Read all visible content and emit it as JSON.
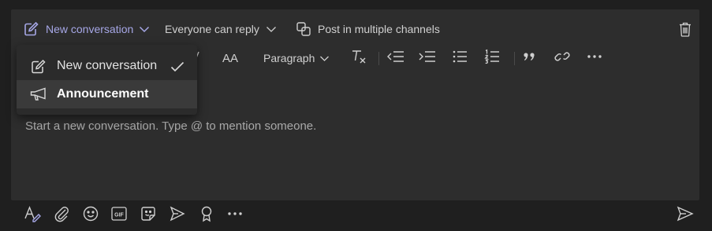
{
  "toolbar": {
    "mode_label": "New conversation",
    "reply_label": "Everyone can reply",
    "multi_label": "Post in multiple channels"
  },
  "format": {
    "font_size_label": "AA",
    "paragraph_label": "Paragraph"
  },
  "dropdown": {
    "items": [
      {
        "label": "New conversation",
        "icon": "compose-icon",
        "checked": true
      },
      {
        "label": "Announcement",
        "icon": "megaphone-icon",
        "checked": false
      }
    ]
  },
  "editor": {
    "placeholder": "Start a new conversation. Type @ to mention someone."
  },
  "bottom": {
    "icons": [
      "format-icon",
      "attach-icon",
      "emoji-icon",
      "gif-icon",
      "sticker-icon",
      "meet-icon",
      "praise-icon",
      "more-icon",
      "send-icon"
    ]
  },
  "colors": {
    "background": "#1f1f1f",
    "composer": "#2d2d2d",
    "accent": "#a6a7e6",
    "text": "#d6d6d6"
  }
}
